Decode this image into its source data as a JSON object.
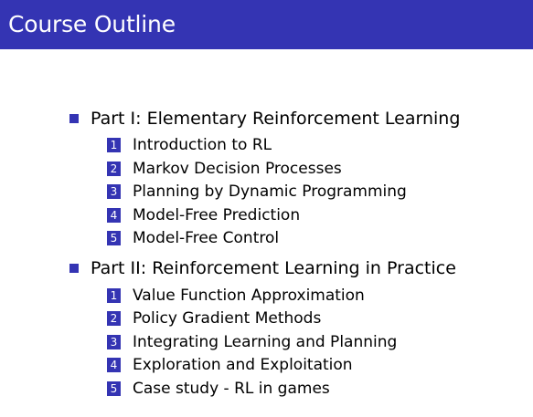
{
  "slide": {
    "title": "Course Outline"
  },
  "outline": {
    "parts": [
      {
        "label": "Part I: Elementary Reinforcement Learning",
        "items": [
          {
            "number": "1",
            "label": "Introduction to RL"
          },
          {
            "number": "2",
            "label": "Markov Decision Processes"
          },
          {
            "number": "3",
            "label": "Planning by Dynamic Programming"
          },
          {
            "number": "4",
            "label": "Model-Free Prediction"
          },
          {
            "number": "5",
            "label": "Model-Free Control"
          }
        ]
      },
      {
        "label": "Part II: Reinforcement Learning in Practice",
        "items": [
          {
            "number": "1",
            "label": "Value Function Approximation"
          },
          {
            "number": "2",
            "label": "Policy Gradient Methods"
          },
          {
            "number": "3",
            "label": "Integrating Learning and Planning"
          },
          {
            "number": "4",
            "label": "Exploration and Exploitation"
          },
          {
            "number": "5",
            "label": "Case study - RL in games"
          }
        ]
      }
    ]
  },
  "colors": {
    "accent": "#3434b3",
    "background": "#ffffff",
    "text": "#000000"
  }
}
